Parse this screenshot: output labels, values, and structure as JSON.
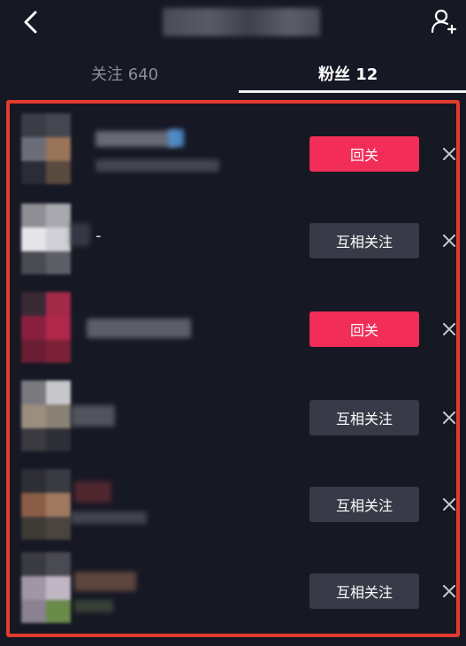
{
  "header": {
    "back_icon": "chevron-left-icon",
    "add_user_icon": "add-user-icon"
  },
  "tabs": [
    {
      "label": "关注 640",
      "active": false
    },
    {
      "label": "粉丝 12",
      "active": true
    }
  ],
  "colors": {
    "background": "#161824",
    "accent_red": "#f22d57",
    "button_gray": "#383b47",
    "highlight_frame": "#e33b2f"
  },
  "rows": [
    {
      "name": "",
      "button_label": "回关",
      "button_style": "red"
    },
    {
      "name": "-",
      "button_label": "互相关注",
      "button_style": "gray"
    },
    {
      "name": "",
      "button_label": "回关",
      "button_style": "red"
    },
    {
      "name": "",
      "button_label": "互相关注",
      "button_style": "gray"
    },
    {
      "name": "",
      "button_label": "互相关注",
      "button_style": "gray"
    },
    {
      "name": "",
      "button_label": "互相关注",
      "button_style": "gray"
    }
  ]
}
